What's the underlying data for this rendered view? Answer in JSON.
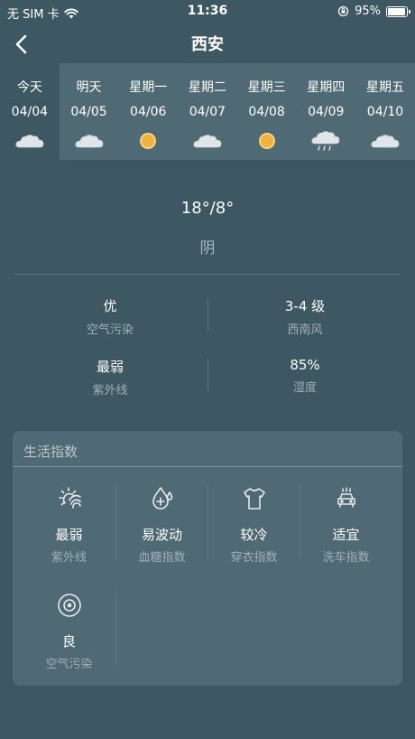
{
  "status_bar": {
    "carrier": "无 SIM 卡",
    "time": "11:36",
    "battery": "95%",
    "battery_level": 0.95
  },
  "nav": {
    "title": "西安"
  },
  "forecast": [
    {
      "name": "今天",
      "date": "04/04",
      "icon": "cloudy-icon"
    },
    {
      "name": "明天",
      "date": "04/05",
      "icon": "cloudy-icon"
    },
    {
      "name": "星期一",
      "date": "04/06",
      "icon": "sunny-icon"
    },
    {
      "name": "星期二",
      "date": "04/07",
      "icon": "cloudy-icon"
    },
    {
      "name": "星期三",
      "date": "04/08",
      "icon": "sunny-icon"
    },
    {
      "name": "星期四",
      "date": "04/09",
      "icon": "rain-icon"
    },
    {
      "name": "星期五",
      "date": "04/10",
      "icon": "cloudy-icon"
    }
  ],
  "current": {
    "temp": "18°/8°",
    "condition": "阴"
  },
  "stats": [
    {
      "value": "优",
      "label": "空气污染"
    },
    {
      "value": "3-4 级",
      "label": "西南风"
    },
    {
      "value": "最弱",
      "label": "紫外线"
    },
    {
      "value": "85%",
      "label": "湿度"
    }
  ],
  "life_index": {
    "title": "生活指数",
    "items": [
      {
        "value": "最弱",
        "label": "紫外线",
        "icon": "sun-uv-icon"
      },
      {
        "value": "易波动",
        "label": "血糖指数",
        "icon": "blood-drop-icon"
      },
      {
        "value": "较冷",
        "label": "穿衣指数",
        "icon": "tshirt-icon"
      },
      {
        "value": "适宜",
        "label": "洗车指数",
        "icon": "car-wash-icon"
      },
      {
        "value": "良",
        "label": "空气污染",
        "icon": "target-icon"
      }
    ]
  },
  "colors": {
    "background": "#3d5863",
    "strip": "#4f6a74",
    "sun": "#f0b23c"
  }
}
